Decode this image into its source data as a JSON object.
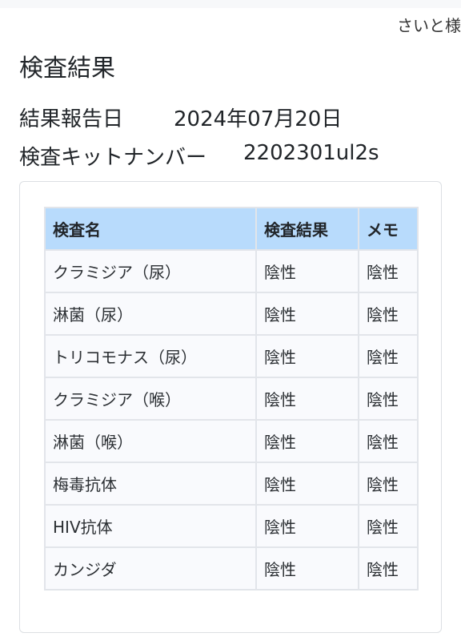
{
  "header": {
    "user_name": "さいと様"
  },
  "page": {
    "title": "検査結果"
  },
  "info": {
    "report_date_label": "結果報告日",
    "report_date_value": "2024年07月20日",
    "kit_number_label": "検査キットナンバー",
    "kit_number_value": "2202301ul2s"
  },
  "table": {
    "columns": [
      "検査名",
      "検査結果",
      "メモ"
    ],
    "rows": [
      {
        "name": "クラミジア（尿）",
        "result": "陰性",
        "memo": "陰性"
      },
      {
        "name": "淋菌（尿）",
        "result": "陰性",
        "memo": "陰性"
      },
      {
        "name": "トリコモナス（尿）",
        "result": "陰性",
        "memo": "陰性"
      },
      {
        "name": "クラミジア（喉）",
        "result": "陰性",
        "memo": "陰性"
      },
      {
        "name": "淋菌（喉）",
        "result": "陰性",
        "memo": "陰性"
      },
      {
        "name": "梅毒抗体",
        "result": "陰性",
        "memo": "陰性"
      },
      {
        "name": "HIV抗体",
        "result": "陰性",
        "memo": "陰性"
      },
      {
        "name": "カンジダ",
        "result": "陰性",
        "memo": "陰性"
      }
    ]
  },
  "colors": {
    "header_bg": "#b8dbfc",
    "row_bg": "#f9fafd",
    "border": "#e2e5ea"
  }
}
